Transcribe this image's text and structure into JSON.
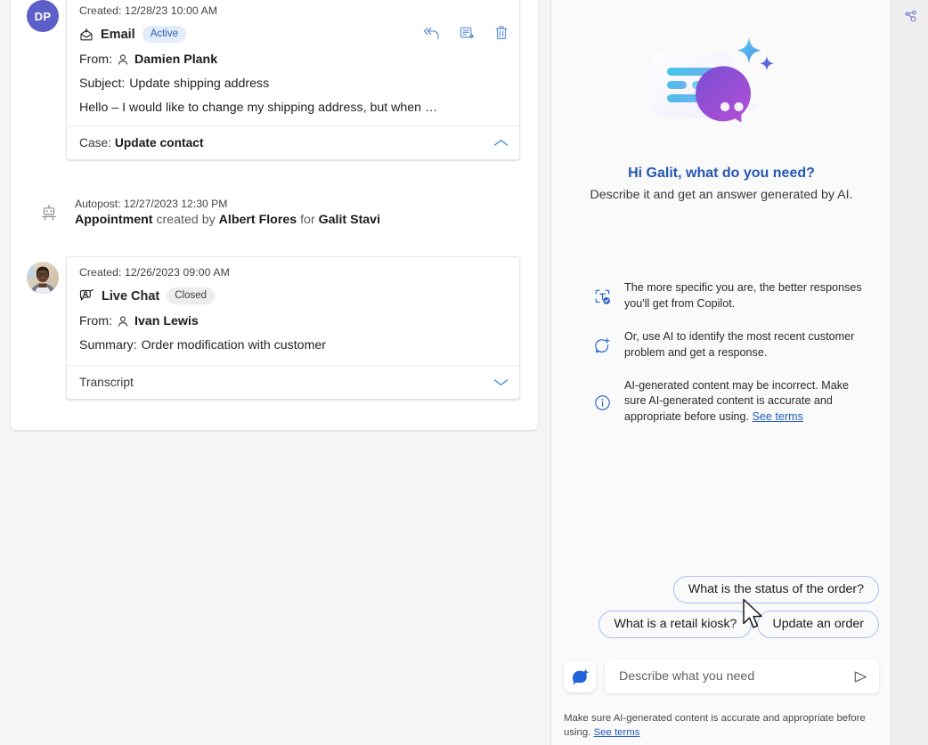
{
  "timeline": {
    "entries": [
      {
        "kind": "email",
        "avatar_type": "initials",
        "avatar_initials": "DP",
        "avatar_color": "#5b5fc7",
        "created_label": "Created:",
        "created_value": "12/28/23  10:00 AM",
        "type_label": "Email",
        "type_icon": "email-open-icon",
        "status_badge": "Active",
        "badge_style": "active",
        "from_label": "From:",
        "from_value": "Damien Plank",
        "subject_label": "Subject:",
        "subject_value": "Update shipping address",
        "snippet": "Hello – I would like to change my shipping address, but when …",
        "footer_label": "Case:",
        "footer_value": "Update contact",
        "footer_chevron": "chevron-up-icon",
        "actions": [
          {
            "name": "reply-all-button",
            "icon": "reply-all-icon"
          },
          {
            "name": "forward-button",
            "icon": "forward-icon"
          },
          {
            "name": "delete-button",
            "icon": "trash-icon"
          }
        ]
      },
      {
        "kind": "autopost",
        "icon": "bot-icon",
        "created_label": "Autopost:",
        "created_value": "12/27/2023  12:30 PM",
        "desc_1": "Appointment",
        "desc_2": "created by",
        "desc_3": "Albert Flores",
        "desc_4": "for",
        "desc_5": "Galit Stavi"
      },
      {
        "kind": "livechat",
        "avatar_type": "photo",
        "avatar_alt": "Ivan Lewis profile photo",
        "created_label": "Created:",
        "created_value": "12/26/2023  09:00 AM",
        "type_label": "Live Chat",
        "type_icon": "live-chat-icon",
        "status_badge": "Closed",
        "badge_style": "closed",
        "from_label": "From:",
        "from_value": "Ivan Lewis",
        "summary_label": "Summary:",
        "summary_value": "Order modification with customer",
        "footer_label": "Transcript",
        "footer_value": "",
        "footer_chevron": "chevron-down-icon"
      }
    ]
  },
  "copilot": {
    "rail": {
      "icon": "share-relationship-icon"
    },
    "hero": {
      "illustration": "ai-chat-sparkle-illustration",
      "title": "Hi Galit, what do you need?",
      "subtitle": "Describe it and get an answer generated by AI."
    },
    "tips": [
      {
        "icon": "scan-check-icon",
        "text": "The more specific you are, the better responses you'll get from Copilot."
      },
      {
        "icon": "chat-sparkle-icon",
        "text": "Or, use AI to identify the most recent customer problem and get a response."
      },
      {
        "icon": "info-icon",
        "text": "AI-generated content may be incorrect. Make sure AI-generated content is accurate and appropriate before using. ",
        "link_text": "See terms"
      }
    ],
    "suggestions": {
      "row1": [
        "What is the status of the order?"
      ],
      "row2": [
        "What is a retail kiosk?",
        "Update an order"
      ]
    },
    "composer": {
      "fab_icon": "copilot-icon",
      "placeholder": "Describe what you need",
      "value": "",
      "send_icon": "send-icon"
    },
    "disclaimer": {
      "text": "Make sure AI-generated content is accurate and appropriate before using. ",
      "link_text": "See terms"
    }
  },
  "colors": {
    "accent_blue": "#2557b5",
    "link_blue": "#1f5bbf",
    "chip_border": "#a9befb",
    "badge_active_bg": "#e3ecfb",
    "badge_closed_bg": "#ececec",
    "page_bg": "#f5f5f5"
  }
}
